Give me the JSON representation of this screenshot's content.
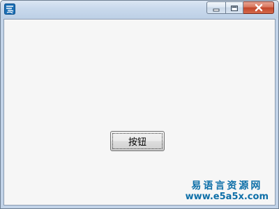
{
  "window": {
    "title": "",
    "icon": "app-logo-icon",
    "caption_buttons": [
      {
        "name": "minimize",
        "icon": "minimize-icon"
      },
      {
        "name": "maximize",
        "icon": "maximize-icon"
      },
      {
        "name": "close",
        "icon": "close-icon"
      }
    ]
  },
  "main": {
    "button_label": "按钮"
  },
  "watermark": {
    "site_name": "易语言资源网",
    "url": "www.e5a5x.com"
  },
  "colors": {
    "titlebar": "#c9d9ec",
    "client_background": "#f6f6f6",
    "close_button": "#c8503a",
    "watermark": "#0e6fa8"
  }
}
